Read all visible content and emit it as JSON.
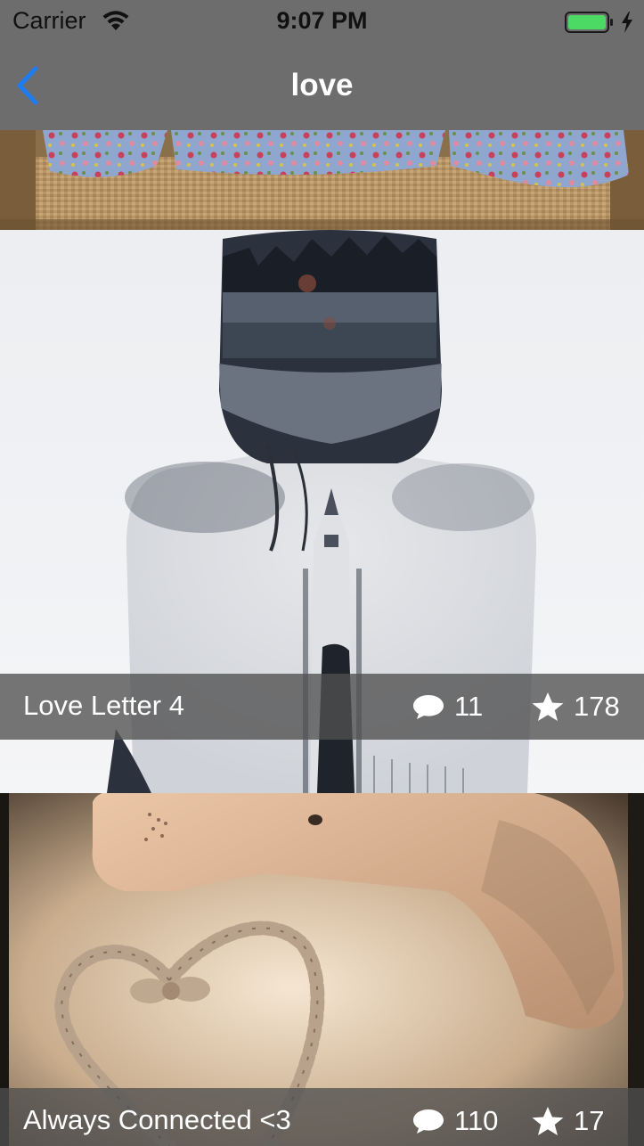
{
  "status_bar": {
    "carrier": "Carrier",
    "time": "9:07 PM",
    "icons": [
      "wifi-icon",
      "battery-icon",
      "charging-icon"
    ]
  },
  "nav": {
    "title": "love",
    "back_icon": "chevron-left-icon",
    "accent_color": "#1e7bf0"
  },
  "posts": [
    {
      "title": "",
      "image": "patterned cushions on a sofa"
    },
    {
      "title": "Love Letter 4",
      "image": "double exposure of a woman's back with a forest and church",
      "comments": "11",
      "stars": "178"
    },
    {
      "title": "Always Connected <3",
      "image": "telephone handset with cord curled into a heart",
      "comments": "110",
      "stars": "17"
    }
  ],
  "colors": {
    "nav_background": "#6d6d6d",
    "caption_overlay": "rgba(80,80,80,0.78)",
    "battery_fill": "#4cd964"
  }
}
